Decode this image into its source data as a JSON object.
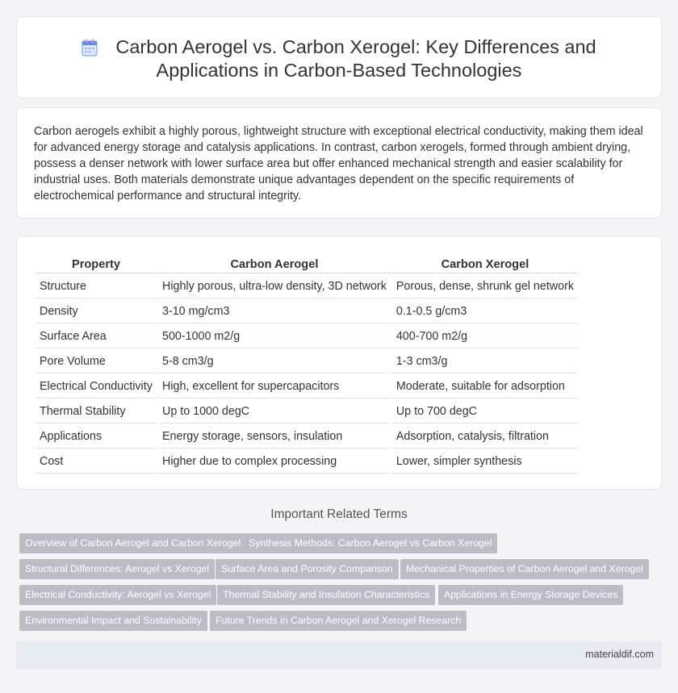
{
  "header": {
    "title_line1": "Carbon Aerogel vs. Carbon Xerogel: Key Differences and",
    "title_line2": "Applications in Carbon-Based Technologies",
    "icon": "document-icon"
  },
  "intro": {
    "text": "Carbon aerogels exhibit a highly porous, lightweight structure with exceptional electrical conductivity, making them ideal for advanced energy storage and catalysis applications. In contrast, carbon xerogels, formed through ambient drying, possess a denser network with lower surface area but offer enhanced mechanical strength and easier scalability for industrial uses. Both materials demonstrate unique advantages dependent on the specific requirements of electrochemical performance and structural integrity."
  },
  "table": {
    "headers": [
      "Property",
      "Carbon Aerogel",
      "Carbon Xerogel"
    ],
    "rows": [
      [
        "Structure",
        "Highly porous, ultra-low density, 3D network",
        "Porous, dense, shrunk gel network"
      ],
      [
        "Density",
        "3-10 mg/cm3",
        "0.1-0.5 g/cm3"
      ],
      [
        "Surface Area",
        "500-1000 m2/g",
        "400-700 m2/g"
      ],
      [
        "Pore Volume",
        "5-8 cm3/g",
        "1-3 cm3/g"
      ],
      [
        "Electrical Conductivity",
        "High, excellent for supercapacitors",
        "Moderate, suitable for adsorption"
      ],
      [
        "Thermal Stability",
        "Up to 1000 degC",
        "Up to 700 degC"
      ],
      [
        "Applications",
        "Energy storage, sensors, insulation",
        "Adsorption, catalysis, filtration"
      ],
      [
        "Cost",
        "Higher due to complex processing",
        "Lower, simpler synthesis"
      ]
    ]
  },
  "related": {
    "heading": "Important Related Terms",
    "terms": [
      "Overview of Carbon Aerogel and Carbon Xerogel",
      "Synthesis Methods: Carbon Aerogel vs Carbon Xerogel",
      "Structural Differences: Aerogel vs Xerogel",
      "Surface Area and Porosity Comparison",
      "Mechanical Properties of Carbon Aerogel and Xerogel",
      "Electrical Conductivity: Aerogel vs Xerogel",
      "Thermal Stability and Insulation Characteristics",
      "Applications in Energy Storage Devices",
      "Environmental Impact and Sustainability",
      "Future Trends in Carbon Aerogel and Xerogel Research"
    ]
  },
  "footer": {
    "site": "materialdif.com"
  },
  "colors": {
    "page_bg": "#f3f4f6",
    "chip_bg": "#b9bec6",
    "footer_bg": "#e6ebf2",
    "icon_blue": "#5b8def",
    "icon_pink": "#e98aa8"
  }
}
